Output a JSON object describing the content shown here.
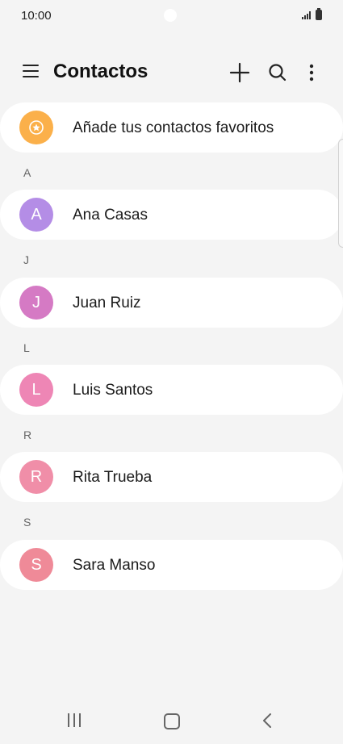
{
  "status": {
    "time": "10:00"
  },
  "header": {
    "title": "Contactos"
  },
  "favorites": {
    "label": "Añade tus contactos favoritos",
    "icon": "star-icon",
    "color": "#fbb04a"
  },
  "sections": [
    {
      "letter": "A",
      "contact": {
        "name": "Ana Casas",
        "initial": "A",
        "color": "#b48de6"
      }
    },
    {
      "letter": "J",
      "contact": {
        "name": "Juan Ruiz",
        "initial": "J",
        "color": "#d57ac4"
      }
    },
    {
      "letter": "L",
      "contact": {
        "name": "Luis Santos",
        "initial": "L",
        "color": "#ee86b5"
      }
    },
    {
      "letter": "R",
      "contact": {
        "name": "Rita Trueba",
        "initial": "R",
        "color": "#f08ea8"
      }
    },
    {
      "letter": "S",
      "contact": {
        "name": "Sara Manso",
        "initial": "S",
        "color": "#ef8a98"
      }
    }
  ]
}
